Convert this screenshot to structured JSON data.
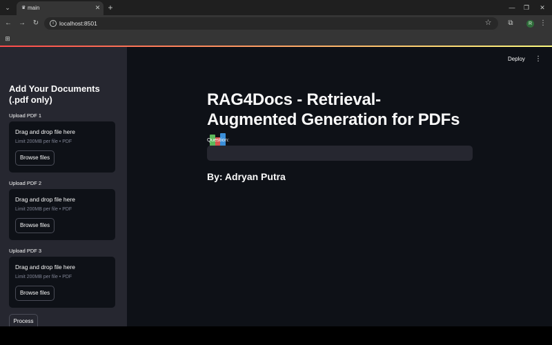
{
  "browser": {
    "tab_title": "main",
    "url": "localhost:8501",
    "profile_initial": "R"
  },
  "app": {
    "deploy_label": "Deploy",
    "sidebar": {
      "title": "Add Your Documents (.pdf only)",
      "uploaders": [
        {
          "label": "Upload PDF 1",
          "drop_text": "Drag and drop file here",
          "limit_text": "Limit 200MB per file • PDF",
          "button": "Browse files"
        },
        {
          "label": "Upload PDF 2",
          "drop_text": "Drag and drop file here",
          "limit_text": "Limit 200MB per file • PDF",
          "button": "Browse files"
        },
        {
          "label": "Upload PDF 3",
          "drop_text": "Drag and drop file here",
          "limit_text": "Limit 200MB per file • PDF",
          "button": "Browse files"
        }
      ],
      "process_button": "Process"
    },
    "main": {
      "title": "RAG4Docs - Retrieval-Augmented Generation for PDFs",
      "title_emoji": "books-icon",
      "question_label": "Question:",
      "question_value": "",
      "byline": "By: Adryan Putra"
    }
  },
  "colors": {
    "app_bg": "#0e1117",
    "sidebar_bg": "#262730",
    "text": "#fafafa",
    "muted_text": "#808495",
    "accent": "#ff4b4b"
  }
}
